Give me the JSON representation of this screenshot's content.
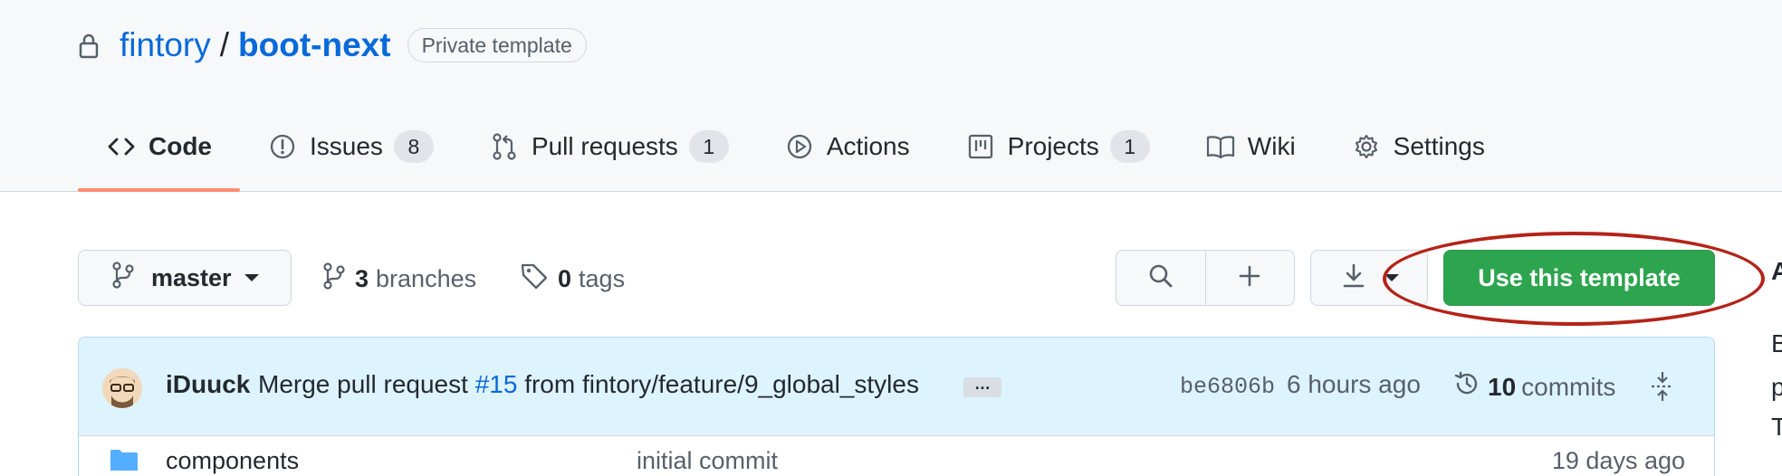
{
  "repo": {
    "owner": "fintory",
    "separator": "/",
    "name": "boot-next",
    "visibility": "Private template"
  },
  "tabs": [
    {
      "label": "Code",
      "icon": "code-icon",
      "selected": true
    },
    {
      "label": "Issues",
      "icon": "issue-icon",
      "count": "8"
    },
    {
      "label": "Pull requests",
      "icon": "pull-request-icon",
      "count": "1"
    },
    {
      "label": "Actions",
      "icon": "play-icon"
    },
    {
      "label": "Projects",
      "icon": "project-icon",
      "count": "1"
    },
    {
      "label": "Wiki",
      "icon": "book-icon"
    },
    {
      "label": "Settings",
      "icon": "gear-icon"
    }
  ],
  "toolbar": {
    "branch": "master",
    "branches_count": "3",
    "branches_label": "branches",
    "tags_count": "0",
    "tags_label": "tags",
    "use_template_label": "Use this template"
  },
  "latest_commit": {
    "author": "iDuuck",
    "message_prefix": "Merge pull request",
    "pr_number": "#15",
    "message_suffix": "from fintory/feature/9_global_styles",
    "ellipsis": "…",
    "sha": "be6806b",
    "time": "6 hours ago",
    "commit_count": "10",
    "commit_label": "commits"
  },
  "files": [
    {
      "name": "components",
      "commit": "initial commit",
      "age": "19 days ago",
      "type": "folder"
    }
  ],
  "sidebar_edge": [
    "A",
    "B",
    "p",
    "T"
  ],
  "colors": {
    "primary_button": "#2da44e",
    "link": "#0969da",
    "selected_tab_underline": "#fd8c73",
    "annotation_ellipse": "#b42318",
    "commit_bar": "#ddf4ff"
  }
}
